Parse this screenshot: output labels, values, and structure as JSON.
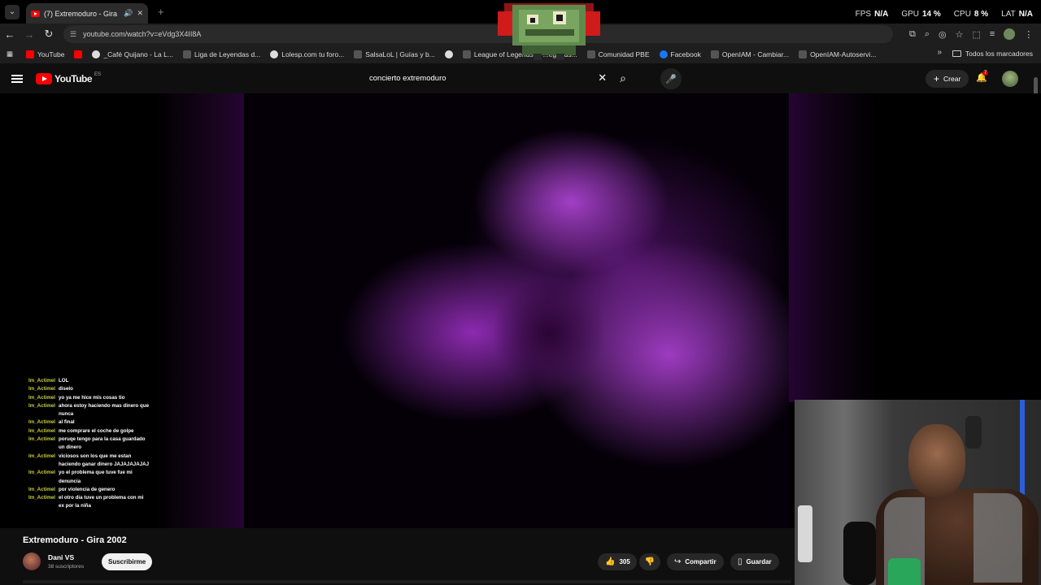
{
  "browser": {
    "tab_title": "(7) Extremoduro - Gira 200...",
    "new_tab_symbol": "+",
    "url": "youtube.com/watch?v=eVdg3X4II8A",
    "stats": [
      {
        "label": "FPS",
        "value": "N/A"
      },
      {
        "label": "GPU",
        "value": "14 %"
      },
      {
        "label": "CPU",
        "value": "8 %"
      },
      {
        "label": "LAT",
        "value": "N/A"
      }
    ],
    "bookmarks": [
      {
        "label": "YouTube",
        "icon": "youtube-icon"
      },
      {
        "label": "",
        "icon": "youtube-icon"
      },
      {
        "label": "_Café Quijano - La L...",
        "icon": "globe-icon"
      },
      {
        "label": "Liga de Leyendas d...",
        "icon": "site-icon"
      },
      {
        "label": "Lolesp.com tu foro...",
        "icon": "globe-icon"
      },
      {
        "label": "SalsaLoL | Guías y b...",
        "icon": "site-icon"
      },
      {
        "label": "",
        "icon": "globe-icon"
      },
      {
        "label": "League of Legends",
        "icon": "lol-icon"
      },
      {
        "label": "...egends...",
        "icon": "site-icon"
      },
      {
        "label": "Comunidad PBE",
        "icon": "site-icon"
      },
      {
        "label": "Facebook",
        "icon": "facebook-icon"
      },
      {
        "label": "OpenIAM - Cambiar...",
        "icon": "site-icon"
      },
      {
        "label": "OpenIAM-Autoservi...",
        "icon": "site-icon"
      }
    ],
    "all_bookmarks": "Todos los marcadores"
  },
  "youtube": {
    "logo_text": "YouTube",
    "logo_country": "ES",
    "search_query": "concierto extremoduro",
    "create_label": "Crear",
    "notifications_count": "7"
  },
  "chat": [
    {
      "user": "Im_Actimel",
      "msg": "LOL"
    },
    {
      "user": "Im_Actimel",
      "msg": "diselo"
    },
    {
      "user": "Im_Actimel",
      "msg": "yo ya me hice mis cosas tio"
    },
    {
      "user": "Im_Actimel",
      "msg": "ahora estoy haciendo mas dinero que nunca"
    },
    {
      "user": "Im_Actimel",
      "msg": "al final"
    },
    {
      "user": "Im_Actimel",
      "msg": "me comprare el coche de golpe"
    },
    {
      "user": "Im_Actimel",
      "msg": "poruqe tengo para la casa guardado un dinero"
    },
    {
      "user": "Im_Actimel",
      "msg": "viciosos son los que me estan haciendo ganar dinero JAJAJAJAJAJ"
    },
    {
      "user": "Im_Actimel",
      "msg": "yo el problema que tuve fue mi denuncia"
    },
    {
      "user": "Im_Actimel",
      "msg": "por violencia de genero"
    },
    {
      "user": "Im_Actimel",
      "msg": "el otro dia tuve un problema con mi ex por la niña"
    }
  ],
  "video": {
    "title": "Extremoduro - Gira 2002",
    "channel": "Dani VS",
    "subscribers": "38 suscriptores",
    "subscribe_label": "Suscribirme",
    "likes": "305",
    "share_label": "Compartir",
    "save_label": "Guardar"
  }
}
